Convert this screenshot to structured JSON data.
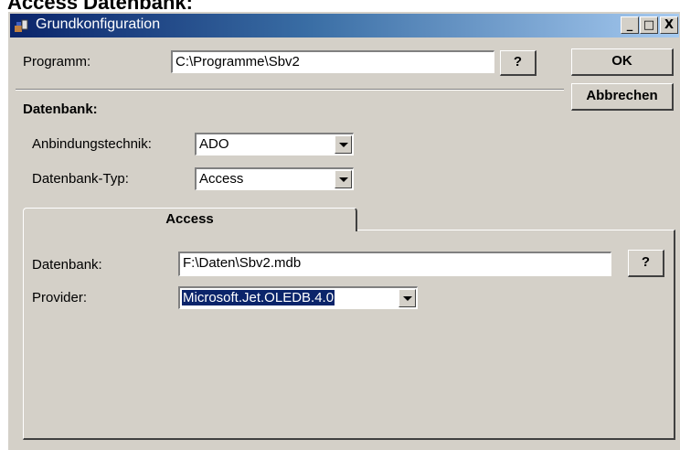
{
  "document": {
    "heading": "Access Datenbank:"
  },
  "window": {
    "title": "Grundkonfiguration",
    "icon": "app-icon",
    "controls": {
      "minimize": "_",
      "maximize": "□",
      "close": "X"
    }
  },
  "programm": {
    "label": "Programm:",
    "value": "C:\\Programme\\Sbv2",
    "help_label": "?"
  },
  "buttons": {
    "ok": "OK",
    "cancel": "Abbrechen"
  },
  "datenbank_section": {
    "heading": "Datenbank:",
    "anbindung_label": "Anbindungstechnik:",
    "anbindung_value": "ADO",
    "typ_label": "Datenbank-Typ:",
    "typ_value": "Access"
  },
  "tab": {
    "label": "Access",
    "datenbank_label": "Datenbank:",
    "datenbank_value": "F:\\Daten\\Sbv2.mdb",
    "help_label": "?",
    "provider_label": "Provider:",
    "provider_value": "Microsoft.Jet.OLEDB.4.0"
  },
  "colors": {
    "titlebar_start": "#0a246a",
    "titlebar_end": "#a6caf0",
    "face": "#d4d0c8",
    "selection": "#0a246a"
  }
}
